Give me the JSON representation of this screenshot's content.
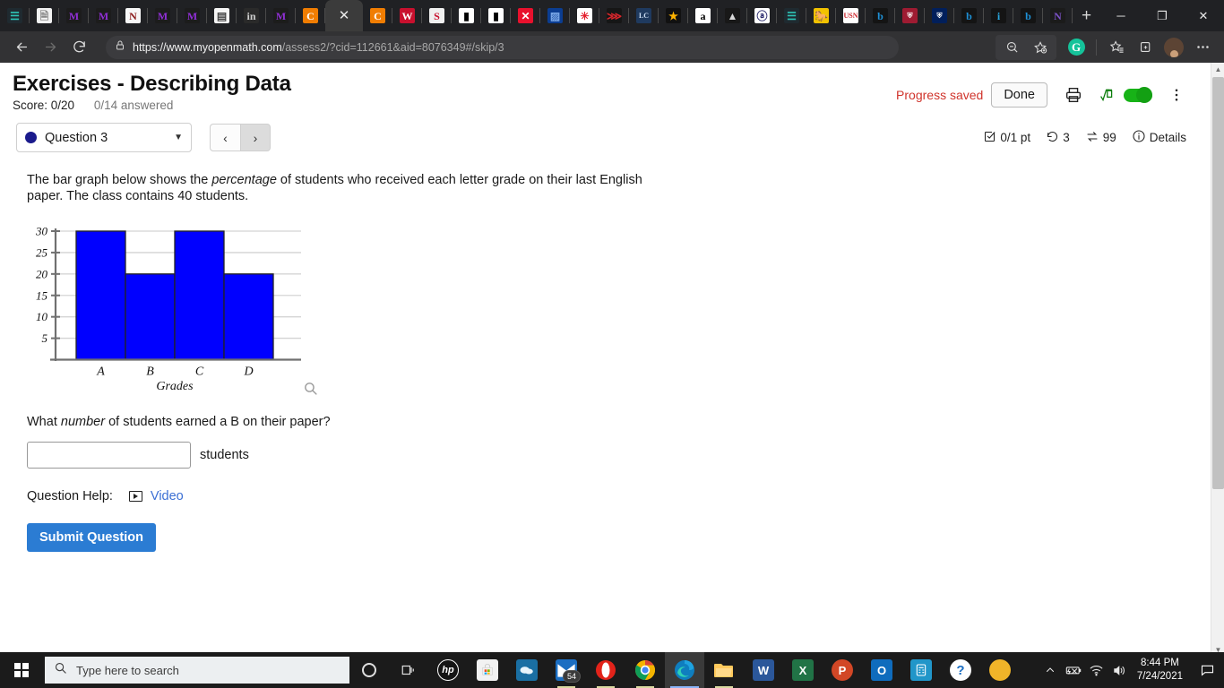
{
  "browser": {
    "tabs": [
      {
        "name": "tab-canvas-teal",
        "glyph": "☰",
        "style": "fav-teal"
      },
      {
        "name": "tab-document",
        "glyph": "🗎",
        "style": "fav-page"
      },
      {
        "name": "tab-mcgraw-1",
        "glyph": "M",
        "style": "fav-purple"
      },
      {
        "name": "tab-mcgraw-2",
        "glyph": "M",
        "style": "fav-purple"
      },
      {
        "name": "tab-northwestern",
        "glyph": "N",
        "style": "fav-nw"
      },
      {
        "name": "tab-mcgraw-3",
        "glyph": "M",
        "style": "fav-purple"
      },
      {
        "name": "tab-mcgraw-4",
        "glyph": "M",
        "style": "fav-purple"
      },
      {
        "name": "tab-document-2",
        "glyph": "▤",
        "style": "fav-doc"
      },
      {
        "name": "tab-linkedin",
        "glyph": "in",
        "style": "fav-in"
      },
      {
        "name": "tab-mcgraw-5",
        "glyph": "M",
        "style": "fav-purple"
      },
      {
        "name": "tab-chegg-1",
        "glyph": "C",
        "style": "fav-orange"
      },
      {
        "name": "tab-active-myopenmath",
        "glyph": "✕",
        "style": "active"
      },
      {
        "name": "tab-chegg-2",
        "glyph": "C",
        "style": "fav-orange"
      },
      {
        "name": "tab-wabash",
        "glyph": "W",
        "style": "fav-w"
      },
      {
        "name": "tab-safeway",
        "glyph": "S",
        "style": "fav-s"
      },
      {
        "name": "tab-colorbars-1",
        "glyph": "▮",
        "style": "fav-bars"
      },
      {
        "name": "tab-colorbars-2",
        "glyph": "▮",
        "style": "fav-bars"
      },
      {
        "name": "tab-puma",
        "glyph": "✕",
        "style": "fav-red"
      },
      {
        "name": "tab-blueprint",
        "glyph": "▨",
        "style": "fav-blue2"
      },
      {
        "name": "tab-walmart",
        "glyph": "✳",
        "style": "fav-wmt"
      },
      {
        "name": "tab-reebok",
        "glyph": "⋙",
        "style": "fav-redstar"
      },
      {
        "name": "tab-lc",
        "glyph": "LC",
        "style": "fav-lc"
      },
      {
        "name": "tab-macys",
        "glyph": "★",
        "style": "fav-star"
      },
      {
        "name": "tab-amazon",
        "glyph": "a",
        "style": "fav-amz"
      },
      {
        "name": "tab-adidas",
        "glyph": "▲",
        "style": "fav-tri"
      },
      {
        "name": "tab-aol",
        "glyph": "ⓐ",
        "style": "fav-a"
      },
      {
        "name": "tab-canvas-teal-2",
        "glyph": "☰",
        "style": "fav-teal"
      },
      {
        "name": "tab-wyoming",
        "glyph": "🐎",
        "style": "fav-yellow"
      },
      {
        "name": "tab-usnews",
        "glyph": "USN",
        "style": "fav-usn"
      },
      {
        "name": "tab-bing-1",
        "glyph": "b",
        "style": "fav-bing"
      },
      {
        "name": "tab-crest-1",
        "glyph": "⛨",
        "style": "fav-crest"
      },
      {
        "name": "tab-crest-2",
        "glyph": "⛨",
        "style": "fav-crest2"
      },
      {
        "name": "tab-bing-2",
        "glyph": "b",
        "style": "fav-bing"
      },
      {
        "name": "tab-info",
        "glyph": "i",
        "style": "fav-i"
      },
      {
        "name": "tab-bing-3",
        "glyph": "b",
        "style": "fav-bing"
      },
      {
        "name": "tab-nyu",
        "glyph": "N",
        "style": "fav-n"
      }
    ],
    "new_tab_label": "+",
    "window_controls": {
      "minimize": "─",
      "maximize": "❐",
      "close": "✕"
    },
    "url_scheme": "https://",
    "url_host": "www.myopenmath.com",
    "url_path": "/assess2/?cid=112661&aid=8076349#/skip/3",
    "url_full": "https://www.myopenmath.com/assess2/?cid=112661&aid=8076349#/skip/3"
  },
  "header": {
    "title": "Exercises - Describing Data",
    "score_label": "Score: 0/20",
    "answered_label": "0/14 answered",
    "progress_saved": "Progress saved",
    "done_label": "Done",
    "colors": {
      "progress_saved": "#d0342c",
      "toggle_on": "#17b317",
      "accent": "#2b7cd3"
    }
  },
  "qnav": {
    "question_label": "Question 3",
    "prev_label": "‹",
    "next_label": "›",
    "points": "0/1 pt",
    "attempts": "3",
    "versions": "99",
    "details_label": "Details"
  },
  "question": {
    "intro_part1": "The bar graph below shows the ",
    "intro_italic": "percentage",
    "intro_part2": " of students who received each letter grade on their last English paper. The class contains 40 students.",
    "prompt_part1": "What ",
    "prompt_italic": "number",
    "prompt_part2": " of students earned a B on their paper?",
    "answer_value": "",
    "answer_units": "students",
    "help_label": "Question Help:",
    "video_label": "Video",
    "submit_label": "Submit Question"
  },
  "chart_data": {
    "type": "bar",
    "title": "",
    "categories": [
      "A",
      "B",
      "C",
      "D"
    ],
    "values": [
      30,
      20,
      30,
      20
    ],
    "xlabel": "Grades",
    "ylabel": "",
    "ylim": [
      0,
      30
    ],
    "yticks": [
      5,
      10,
      15,
      20,
      25,
      30
    ],
    "ytick_labels": [
      "5",
      "10",
      "15",
      "20",
      "25",
      "30"
    ],
    "bar_color": "#0000ff",
    "bar_edge_color": "#222222",
    "grid": true,
    "grid_color": "#d4d4d4",
    "axis_color": "#707070",
    "legend": null
  },
  "taskbar": {
    "search_placeholder": "Type here to search",
    "items": [
      {
        "name": "taskview-button",
        "glyph": "▭"
      },
      {
        "name": "hp-app",
        "glyph": "hp"
      },
      {
        "name": "microsoft-store-app",
        "glyph": "🛍"
      },
      {
        "name": "onedrive-app",
        "glyph": "☁"
      },
      {
        "name": "mail-app",
        "glyph": "✉",
        "badge": "54"
      },
      {
        "name": "opera-browser-app",
        "glyph": "O"
      },
      {
        "name": "chrome-browser-app",
        "glyph": "◉"
      },
      {
        "name": "edge-browser-app",
        "glyph": "e",
        "active": true
      },
      {
        "name": "file-explorer-app",
        "glyph": "📁"
      },
      {
        "name": "word-app",
        "glyph": "W"
      },
      {
        "name": "excel-app",
        "glyph": "X"
      },
      {
        "name": "powerpoint-app",
        "glyph": "P"
      },
      {
        "name": "outlook-app",
        "glyph": "O"
      },
      {
        "name": "calculator-app",
        "glyph": "▤"
      },
      {
        "name": "help-app",
        "glyph": "?"
      },
      {
        "name": "circle-app",
        "glyph": "●"
      }
    ],
    "tray": {
      "chevron": "⌃",
      "battery": "🔋",
      "wifi": "📶",
      "volume": "🔊",
      "time": "8:44 PM",
      "date": "7/24/2021"
    }
  }
}
